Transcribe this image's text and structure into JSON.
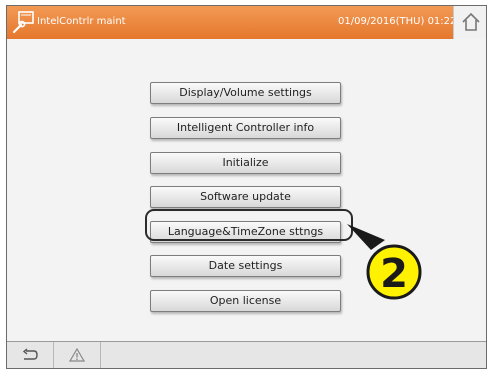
{
  "header": {
    "title": "IntelContrlr maint",
    "datetime": "01/09/2016(THU) 01:22",
    "home_icon": "home-icon",
    "tool_icon": "settings-tool-icon"
  },
  "menu": {
    "items": [
      {
        "label": "Display/Volume settings"
      },
      {
        "label": "Intelligent Controller info"
      },
      {
        "label": "Initialize"
      },
      {
        "label": "Software update"
      },
      {
        "label": "Language&TimeZone sttngs"
      },
      {
        "label": "Date settings"
      },
      {
        "label": "Open license"
      }
    ],
    "highlighted_item": "Language&TimeZone sttngs"
  },
  "callout": {
    "number": "2"
  },
  "footer": {
    "back_icon": "back-arrow-icon",
    "warning_icon": "warning-triangle-icon"
  },
  "colors": {
    "header_orange": "#e8802f",
    "callout_yellow": "#fff200"
  }
}
